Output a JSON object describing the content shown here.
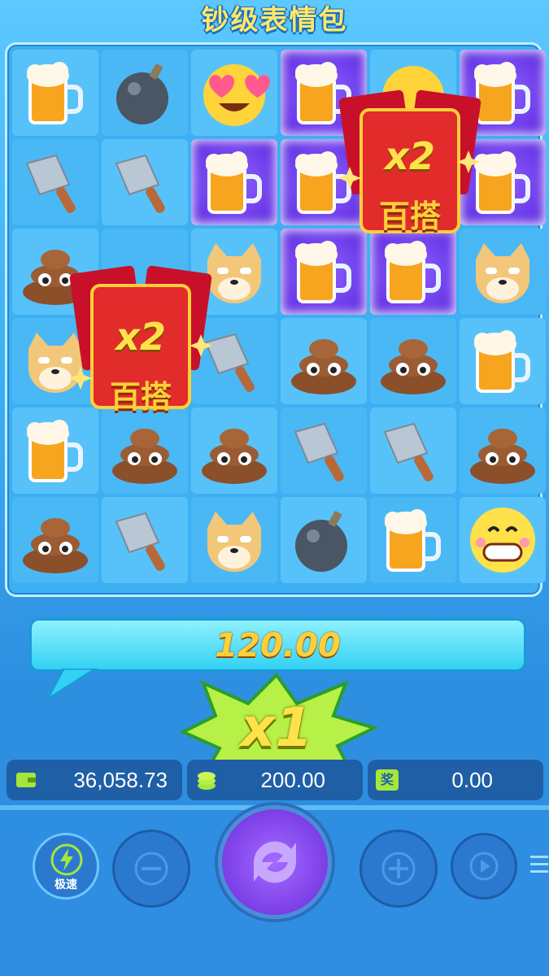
{
  "game": {
    "title": "钞级表情包"
  },
  "multiplier_badges": [
    {
      "text": "x2",
      "label": "百搭"
    },
    {
      "text": "x2",
      "label": "百搭"
    }
  ],
  "win": {
    "amount": "120.00"
  },
  "multiplier": {
    "text": "x1"
  },
  "stats": {
    "balance": "36,058.73",
    "bet": "200.00",
    "win": "0.00",
    "win_icon_label": "奖"
  },
  "controls": {
    "turbo_label": "极速",
    "minus_icon": "minus-icon",
    "spin_icon": "spin-icon",
    "plus_icon": "plus-icon",
    "autoplay_icon": "play-icon",
    "menu_icon": "menu-icon"
  },
  "colors": {
    "highlight": "#6a38e8",
    "accent": "#ffe24a",
    "bar": "#33d1f3"
  }
}
